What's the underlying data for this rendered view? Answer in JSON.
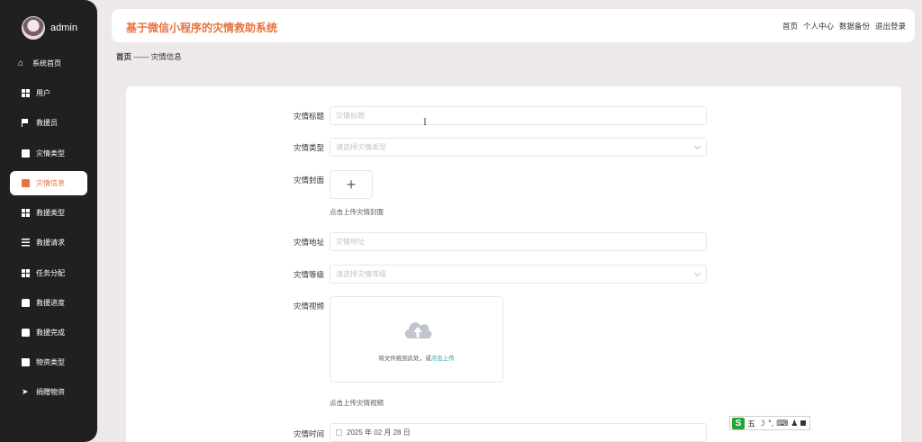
{
  "user": {
    "name": "admin"
  },
  "sidebar": {
    "items": [
      {
        "label": "系统首页",
        "icon": "home-icon"
      },
      {
        "label": "用户",
        "icon": "grid-icon"
      },
      {
        "label": "救援员",
        "icon": "flag-icon"
      },
      {
        "label": "灾情类型",
        "icon": "chat-icon"
      },
      {
        "label": "灾情信息",
        "icon": "clipboard-icon",
        "active": true
      },
      {
        "label": "救援类型",
        "icon": "grid-icon"
      },
      {
        "label": "救援请求",
        "icon": "sliders-icon"
      },
      {
        "label": "任务分配",
        "icon": "grid-icon"
      },
      {
        "label": "救援进度",
        "icon": "briefcase-icon"
      },
      {
        "label": "救援完成",
        "icon": "clipboard-icon"
      },
      {
        "label": "物资类型",
        "icon": "book-icon"
      },
      {
        "label": "捐赠物资",
        "icon": "send-icon"
      }
    ]
  },
  "header": {
    "title": "基于微信小程序的灾情救助系统",
    "links": [
      "首页",
      "个人中心",
      "数据备份",
      "退出登录"
    ]
  },
  "breadcrumb": {
    "home": "首页",
    "sep": " —— ",
    "current": "灾情信息"
  },
  "form": {
    "title_label": "灾情标题",
    "title_placeholder": "灾情标题",
    "type_label": "灾情类型",
    "type_placeholder": "请选择灾情类型",
    "cover_label": "灾情封面",
    "cover_hint": "点击上传灾情封面",
    "address_label": "灾情地址",
    "address_placeholder": "灾情地址",
    "level_label": "灾情等级",
    "level_placeholder": "请选择灾情等级",
    "video_label": "灾情视频",
    "video_drag_text": "将文件拖到此处，或",
    "video_drag_link": "点击上传",
    "video_hint": "点击上传灾情视频",
    "time_label": "灾情时间",
    "time_value": "2025 年 02 月 28 日"
  },
  "ime": {
    "brand": "S",
    "mode": "五"
  },
  "colors": {
    "accent": "#e8733d",
    "sidebar": "#202020",
    "link": "#2aa3a3"
  }
}
